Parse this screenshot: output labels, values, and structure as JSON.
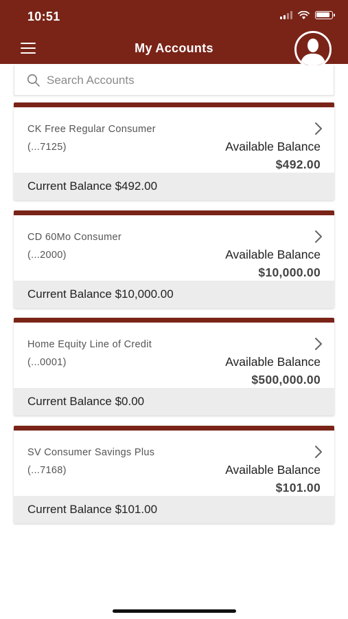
{
  "status_bar": {
    "time": "10:51"
  },
  "header": {
    "title": "My Accounts",
    "menu_icon": "hamburger-menu-icon",
    "avatar_icon": "user-avatar-icon"
  },
  "search": {
    "placeholder": "Search Accounts",
    "value": ""
  },
  "accounts": [
    {
      "name": "CK Free Regular Consumer",
      "number": "(...7125)",
      "available_label": "Available Balance",
      "available_balance": "$492.00",
      "current_balance_text": "Current Balance $492.00"
    },
    {
      "name": "CD 60Mo Consumer",
      "number": "(...2000)",
      "available_label": "Available Balance",
      "available_balance": "$10,000.00",
      "current_balance_text": "Current Balance $10,000.00"
    },
    {
      "name": "Home Equity Line of Credit",
      "number": "(...0001)",
      "available_label": "Available Balance",
      "available_balance": "$500,000.00",
      "current_balance_text": "Current Balance $0.00"
    },
    {
      "name": "SV Consumer Savings Plus",
      "number": "(...7168)",
      "available_label": "Available Balance",
      "available_balance": "$101.00",
      "current_balance_text": "Current Balance $101.00"
    }
  ],
  "colors": {
    "brand": "#7a2418",
    "card_footer": "#ececec",
    "background": "#ffffff"
  }
}
